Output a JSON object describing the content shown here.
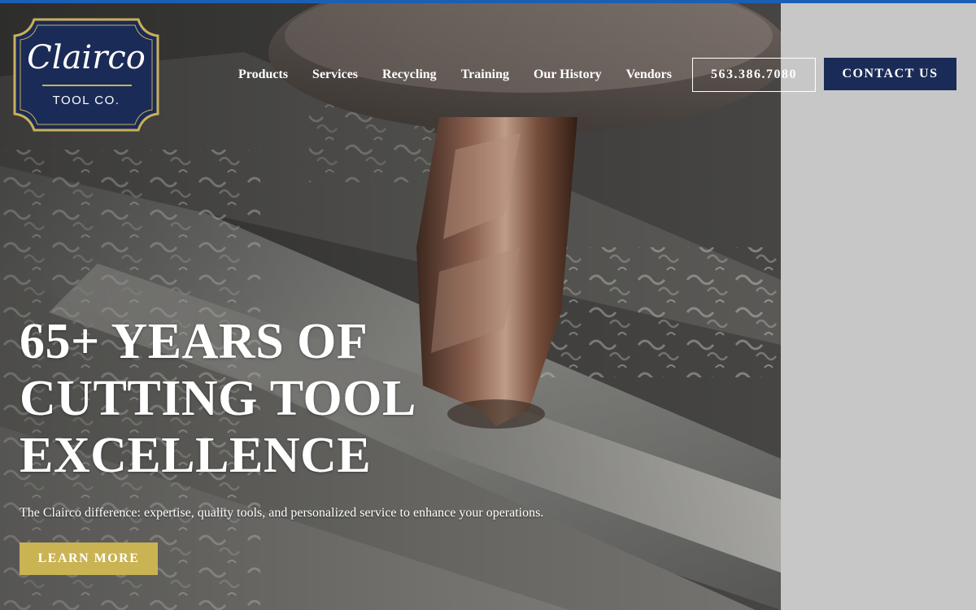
{
  "brand": {
    "logo_script": "Clairco",
    "logo_sub": "TOOL CO.",
    "navy": "#1b2b57",
    "gold": "#c9b353",
    "accent_blue": "#1a5fb4"
  },
  "nav": {
    "items": [
      {
        "label": "Products"
      },
      {
        "label": "Services"
      },
      {
        "label": "Recycling"
      },
      {
        "label": "Training"
      },
      {
        "label": "Our History"
      },
      {
        "label": "Vendors"
      }
    ],
    "phone_label": "563.386.7080",
    "contact_label": "CONTACT US"
  },
  "hero": {
    "headline_lines": [
      "65+ YEARS OF",
      "CUTTING TOOL",
      "EXCELLENCE"
    ],
    "tagline": "The Clairco difference: expertise, quality tools, and personalized service to enhance your operations.",
    "cta_label": "LEARN MORE",
    "background_image": "end-mill-cutting-metal-photo"
  }
}
